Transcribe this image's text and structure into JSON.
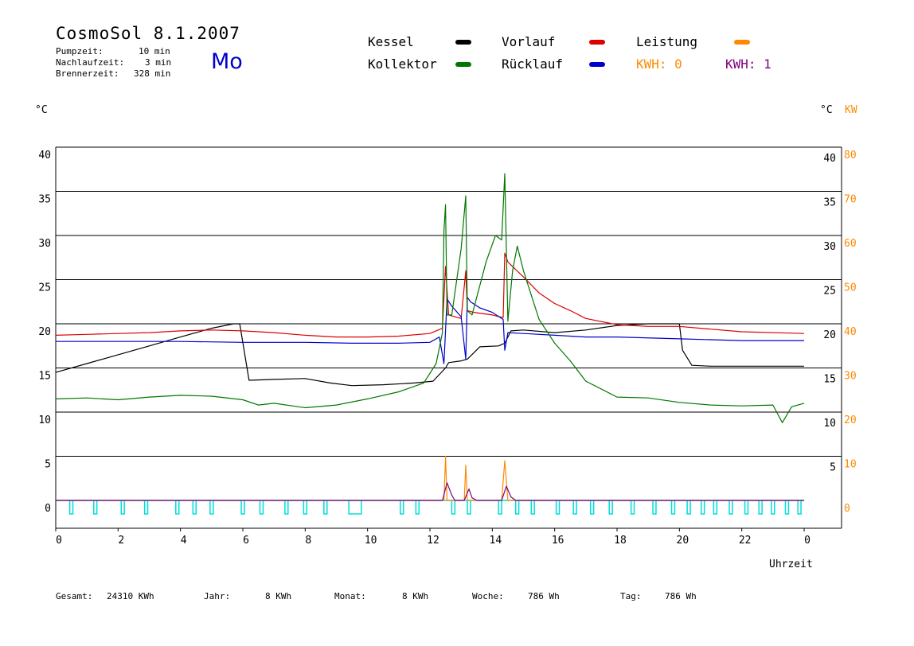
{
  "header": {
    "title": "CosmoSol 8.1.2007",
    "pumpzeit_label": "Pumpzeit:",
    "pumpzeit_value": "10 min",
    "nachlaufzeit_label": "Nachlaufzeit:",
    "nachlaufzeit_value": "3 min",
    "brennerzeit_label": "Brennerzeit:",
    "brennerzeit_value": "328 min",
    "weekday": "Mo"
  },
  "legend": {
    "kessel": "Kessel",
    "vorlauf": "Vorlauf",
    "leistung": "Leistung",
    "kollektor": "Kollektor",
    "ruecklauf": "Rücklauf",
    "kwh0": "KWH: 0",
    "kwh1": "KWH: 1"
  },
  "axis": {
    "left_unit": "°C",
    "right_unit_c": "°C",
    "right_unit_kw": "KW",
    "xlabel": "Uhrzeit"
  },
  "footer": {
    "gesamt_label": "Gesamt:",
    "gesamt_value": "24310 KWh",
    "jahr_label": "Jahr:",
    "jahr_value": "8 KWh",
    "monat_label": "Monat:",
    "monat_value": "8 KWh",
    "woche_label": "Woche:",
    "woche_value": "786 Wh",
    "tag_label": "Tag:",
    "tag_value": "786 Wh"
  },
  "chart_data": {
    "type": "line",
    "x_ticks": [
      "0",
      "2",
      "4",
      "6",
      "8",
      "10",
      "12",
      "14",
      "16",
      "18",
      "20",
      "22",
      "0"
    ],
    "y_left_ticks": [
      0,
      5,
      10,
      15,
      20,
      25,
      30,
      35,
      40
    ],
    "y_right_c_ticks": [
      5,
      10,
      15,
      20,
      25,
      30,
      35,
      40
    ],
    "y_right_kw_ticks": [
      0,
      10,
      20,
      30,
      40,
      50,
      60,
      70,
      80
    ],
    "xlim": [
      0,
      24
    ],
    "ylim": [
      0,
      40
    ],
    "colors": {
      "kessel": "#000000",
      "vorlauf": "#dd0000",
      "ruecklauf": "#0000cc",
      "kollektor": "#007700",
      "leistung": "#ff8800",
      "kwh1": "#800080",
      "pump": "#00dddd"
    },
    "series": [
      {
        "name": "Kessel",
        "key": "kessel",
        "x": [
          0,
          1,
          2,
          3,
          4,
          5,
          5.7,
          5.9,
          6.2,
          7,
          8,
          8.8,
          9.5,
          10.5,
          11.5,
          12.1,
          12.5,
          12.6,
          13,
          13.2,
          13.6,
          14.2,
          14.4,
          14.6,
          15,
          16,
          17,
          18,
          19,
          20,
          20.1,
          20.4,
          21,
          22,
          24
        ],
        "y": [
          14.5,
          15.5,
          16.5,
          17.5,
          18.5,
          19.5,
          20,
          20,
          13.6,
          13.7,
          13.8,
          13.3,
          13,
          13.1,
          13.3,
          13.5,
          15,
          15.6,
          15.8,
          16,
          17.4,
          17.5,
          17.8,
          19.2,
          19.3,
          19,
          19.3,
          19.8,
          20,
          20,
          17,
          15.3,
          15.2,
          15.2,
          15.2
        ]
      },
      {
        "name": "Vorlauf",
        "key": "vorlauf",
        "x": [
          0,
          1,
          2,
          3,
          4,
          5,
          6,
          7,
          8,
          9,
          10,
          11,
          12,
          12.4,
          12.5,
          12.6,
          13,
          13.15,
          13.2,
          13.4,
          14,
          14.35,
          14.4,
          14.5,
          15,
          15.5,
          16,
          16.5,
          17,
          18,
          19,
          20,
          21,
          22,
          24
        ],
        "y": [
          18.7,
          18.8,
          18.9,
          19,
          19.2,
          19.3,
          19.2,
          19,
          18.7,
          18.5,
          18.5,
          18.6,
          18.9,
          19.5,
          26.5,
          21,
          20.6,
          26,
          21.5,
          21.3,
          21,
          20.7,
          28,
          27,
          25.3,
          23.5,
          22.3,
          21.5,
          20.6,
          19.9,
          19.7,
          19.7,
          19.4,
          19.1,
          18.9
        ]
      },
      {
        "name": "Rücklauf",
        "key": "ruecklauf",
        "x": [
          0,
          2,
          4,
          6,
          8,
          9.5,
          11,
          12,
          12.3,
          12.45,
          12.55,
          12.7,
          13,
          13.15,
          13.2,
          13.3,
          13.6,
          14,
          14.35,
          14.4,
          14.5,
          15,
          16,
          17,
          18,
          20,
          22,
          24
        ],
        "y": [
          18,
          18,
          18,
          17.9,
          17.9,
          17.8,
          17.8,
          17.9,
          18.5,
          15.5,
          22.8,
          22,
          20.8,
          16,
          23,
          22.5,
          21.8,
          21.3,
          20.5,
          17,
          19,
          18.9,
          18.7,
          18.5,
          18.5,
          18.3,
          18.1,
          18.1
        ]
      },
      {
        "name": "Kollektor",
        "key": "kollektor",
        "x": [
          0,
          1,
          2,
          3,
          4,
          5,
          6,
          6.5,
          7,
          8,
          9,
          10,
          11,
          11.8,
          12.2,
          12.4,
          12.45,
          12.5,
          12.55,
          12.7,
          13,
          13.15,
          13.2,
          13.35,
          13.8,
          14.1,
          14.3,
          14.4,
          14.5,
          14.65,
          14.8,
          15,
          15.5,
          16,
          16.5,
          17,
          18,
          19,
          20,
          21,
          22,
          23,
          23.3,
          23.6,
          24
        ],
        "y": [
          11.5,
          11.6,
          11.4,
          11.7,
          11.9,
          11.8,
          11.4,
          10.8,
          11,
          10.5,
          10.8,
          11.5,
          12.3,
          13.3,
          15.5,
          19,
          30.5,
          33.5,
          21,
          21,
          28.5,
          34.5,
          21.5,
          21,
          27,
          30,
          29.5,
          37,
          20.3,
          26,
          28.8,
          26,
          20.5,
          17.8,
          15.8,
          13.5,
          11.7,
          11.6,
          11.1,
          10.8,
          10.7,
          10.8,
          8.8,
          10.6,
          11
        ]
      },
      {
        "name": "Leistung",
        "key": "leistung",
        "x": [
          0,
          12.45,
          12.5,
          12.55,
          12.6,
          13.1,
          13.15,
          13.2,
          13.3,
          14.3,
          14.4,
          14.5,
          14.55,
          24
        ],
        "y": [
          0,
          0,
          5,
          0,
          0,
          0,
          4,
          0,
          0,
          0,
          4.5,
          0,
          0,
          0
        ]
      },
      {
        "name": "KWH: 1",
        "key": "kwh1",
        "x": [
          0,
          12.4,
          12.55,
          12.7,
          12.8,
          13.1,
          13.25,
          13.35,
          13.5,
          14.3,
          14.45,
          14.6,
          14.75,
          24
        ],
        "y": [
          0,
          0,
          2,
          0.6,
          0,
          0,
          1.3,
          0.3,
          0,
          0,
          1.6,
          0.4,
          0,
          0
        ]
      }
    ],
    "pump_on": [
      [
        0.45,
        0.55
      ],
      [
        1.22,
        1.32
      ],
      [
        2.1,
        2.2
      ],
      [
        2.85,
        2.95
      ],
      [
        3.85,
        3.95
      ],
      [
        4.4,
        4.5
      ],
      [
        4.95,
        5.05
      ],
      [
        5.95,
        6.05
      ],
      [
        6.55,
        6.65
      ],
      [
        7.35,
        7.45
      ],
      [
        7.95,
        8.05
      ],
      [
        8.6,
        8.7
      ],
      [
        9.4,
        9.8
      ],
      [
        11.05,
        11.15
      ],
      [
        11.55,
        11.65
      ],
      [
        12.7,
        12.8
      ],
      [
        13.2,
        13.3
      ],
      [
        14.2,
        14.3
      ],
      [
        14.75,
        14.85
      ],
      [
        15.25,
        15.35
      ],
      [
        16.05,
        16.15
      ],
      [
        16.6,
        16.7
      ],
      [
        17.15,
        17.25
      ],
      [
        17.75,
        17.85
      ],
      [
        18.45,
        18.55
      ],
      [
        19.15,
        19.25
      ],
      [
        19.75,
        19.85
      ],
      [
        20.25,
        20.35
      ],
      [
        20.7,
        20.8
      ],
      [
        21.1,
        21.2
      ],
      [
        21.6,
        21.7
      ],
      [
        22.1,
        22.2
      ],
      [
        22.55,
        22.65
      ],
      [
        22.95,
        23.05
      ],
      [
        23.4,
        23.5
      ],
      [
        23.8,
        23.9
      ]
    ]
  }
}
